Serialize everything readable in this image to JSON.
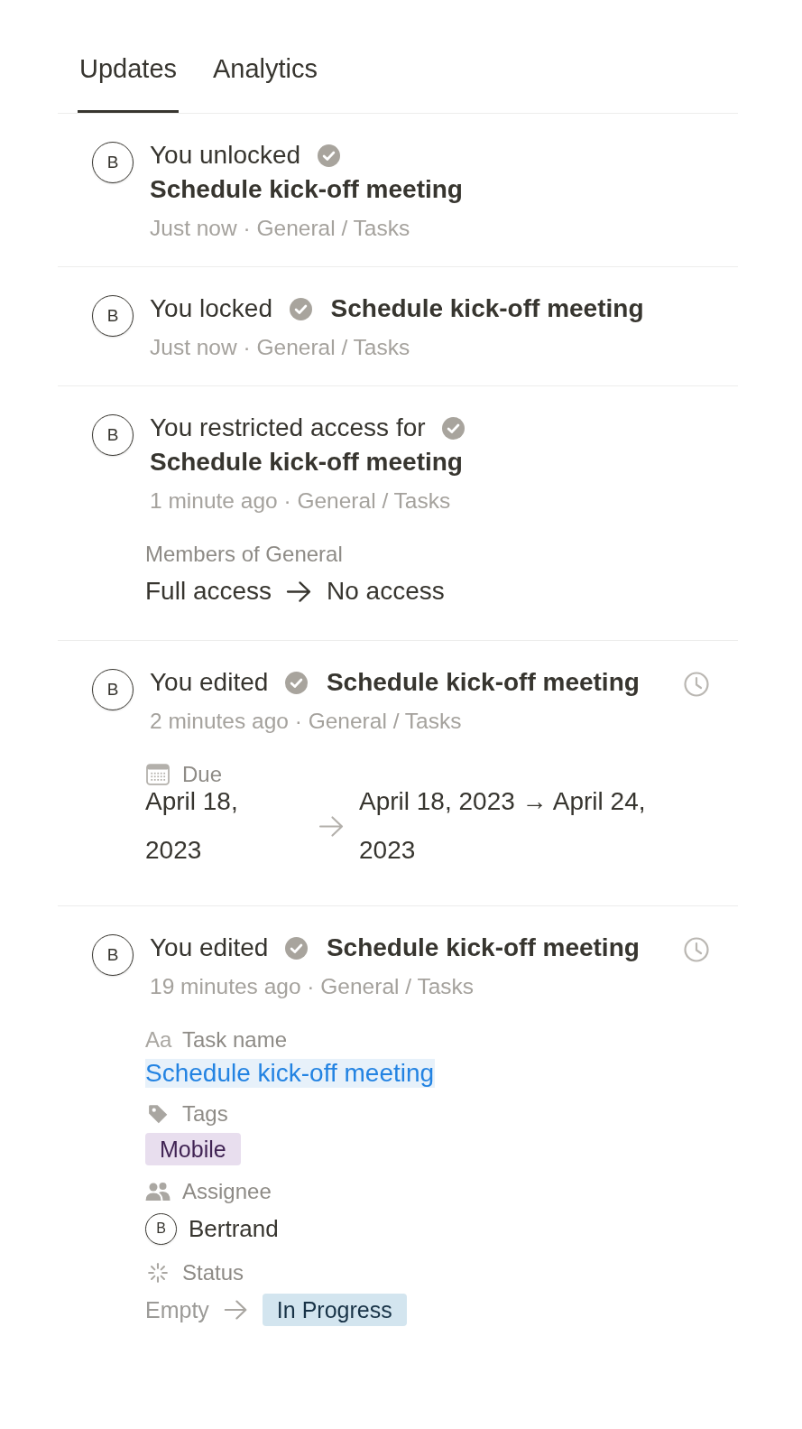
{
  "tabs": [
    {
      "label": "Updates",
      "selected": true
    },
    {
      "label": "Analytics",
      "selected": false
    }
  ],
  "updates": [
    {
      "actor_initial": "B",
      "action": "You unlocked",
      "page_title": "Schedule kick-off meeting",
      "subtitle": "Just now · General / Tasks",
      "history_icon": false
    },
    {
      "actor_initial": "B",
      "action": "You locked",
      "page_title": "Schedule kick-off meeting",
      "subtitle": "Just now · General / Tasks",
      "history_icon": false
    },
    {
      "actor_initial": "B",
      "action": "You restricted access for",
      "page_title": "Schedule kick-off meeting",
      "subtitle": "1 minute ago · General / Tasks",
      "history_icon": false,
      "changes": [
        {
          "kind": "access",
          "label": "Members of General",
          "from": "Full access",
          "to": "No access"
        }
      ]
    },
    {
      "actor_initial": "B",
      "action": "You edited",
      "page_title": "Schedule kick-off meeting",
      "subtitle": "2 minutes ago · General / Tasks",
      "history_icon": true,
      "changes": [
        {
          "kind": "date",
          "label": "Due",
          "from": "April 18, 2023",
          "to": "April 18, 2023 → April 24, 2023"
        }
      ]
    },
    {
      "actor_initial": "B",
      "action": "You edited",
      "page_title": "Schedule kick-off meeting",
      "subtitle": "19 minutes ago · General / Tasks",
      "history_icon": true,
      "changes": [
        {
          "kind": "text",
          "glyph": "Aa",
          "label": "Task name",
          "value": "Schedule kick-off meeting"
        },
        {
          "kind": "tags",
          "label": "Tags",
          "tags": [
            {
              "name": "Mobile",
              "color": "#e8deee"
            }
          ]
        },
        {
          "kind": "person",
          "label": "Assignee",
          "person": {
            "initial": "B",
            "name": "Bertrand"
          }
        },
        {
          "kind": "status",
          "label": "Status",
          "from": "Empty",
          "to": "In Progress",
          "color": "#d3e5ef"
        }
      ]
    }
  ]
}
